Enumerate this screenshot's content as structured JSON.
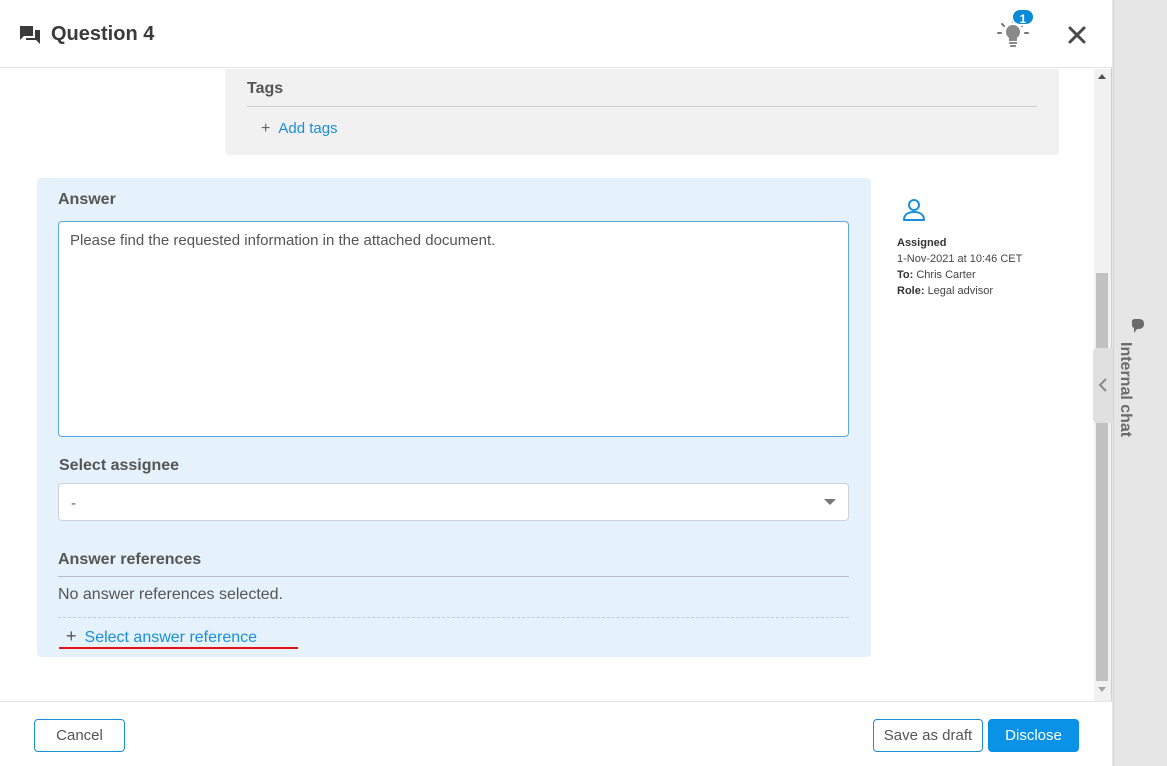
{
  "header": {
    "title": "Question 4",
    "notification_count": "1"
  },
  "tags": {
    "title": "Tags",
    "add_label": "Add tags"
  },
  "answer": {
    "label": "Answer",
    "value": "Please find the requested information in the attached document.",
    "assignee_label": "Select assignee",
    "assignee_value": "-",
    "references_label": "Answer references",
    "references_empty": "No answer references selected.",
    "select_reference_label": "Select answer reference"
  },
  "assigned": {
    "status": "Assigned",
    "datetime": "1-Nov-2021 at 10:46 CET",
    "to_label": "To:",
    "to_value": "Chris Carter",
    "role_label": "Role:",
    "role_value": "Legal advisor"
  },
  "footer": {
    "cancel_label": "Cancel",
    "draft_label": "Save as draft",
    "disclose_label": "Disclose"
  },
  "side_panel": {
    "chat_label": "Internal chat"
  },
  "colors": {
    "accent": "#0a93e6",
    "link": "#1a8fd8",
    "answer_panel_bg": "#e5f2fb",
    "highlight_underline": "#e0131b"
  },
  "icons": [
    "chat-bubbles-icon",
    "lightbulb-icon",
    "close-icon",
    "plus-icon",
    "person-icon",
    "chevron-left-icon",
    "chat-icon"
  ]
}
